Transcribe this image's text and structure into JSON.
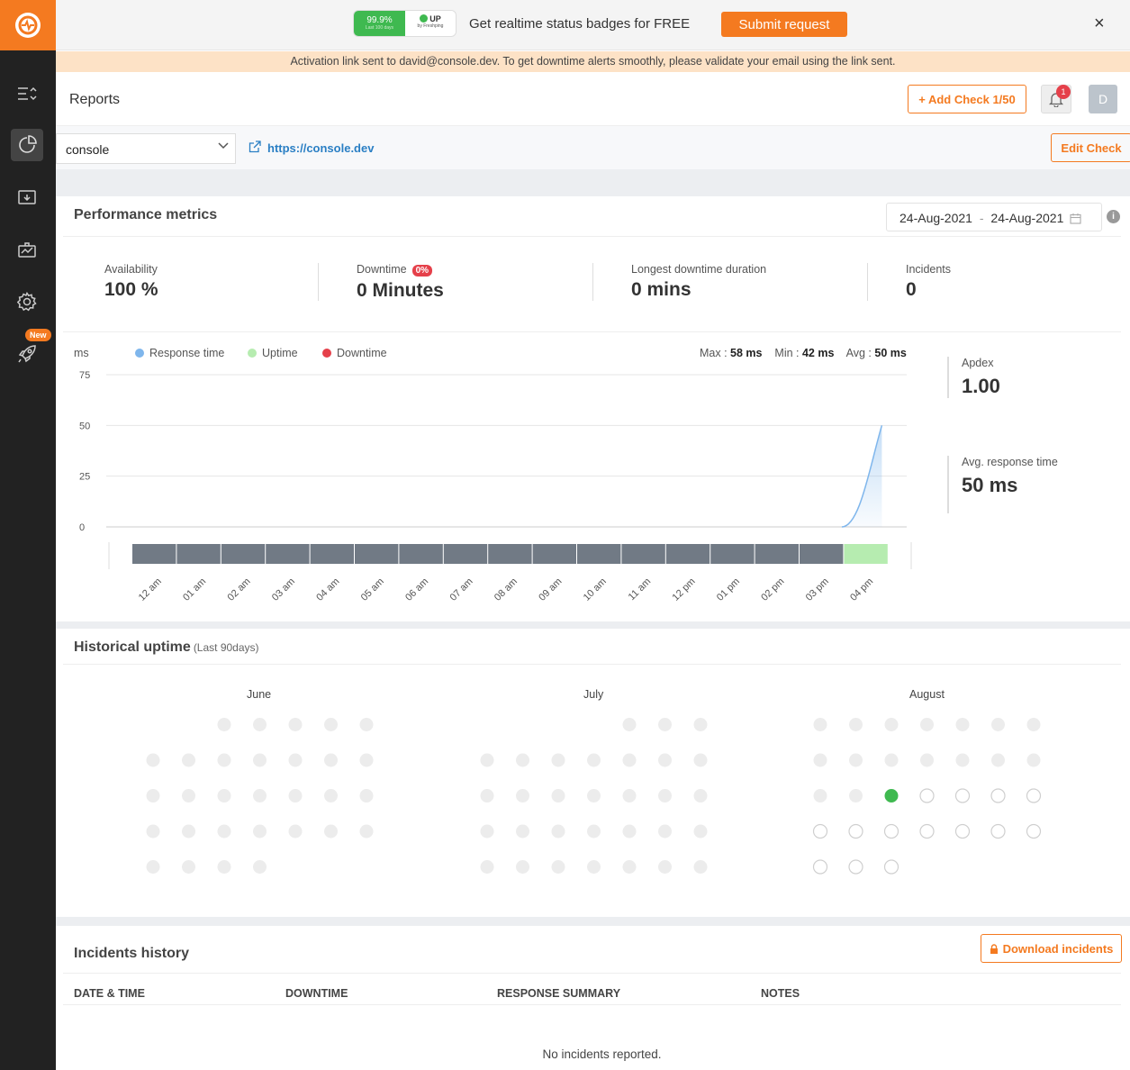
{
  "promo": {
    "badge_pct": "99.9%",
    "badge_sub": "Last 100 days",
    "badge_status": "UP",
    "badge_by": "by Freshping",
    "text": "Get realtime status badges for FREE",
    "submit_label": "Submit request",
    "close_icon": "×"
  },
  "activation": "Activation link sent to david@console.dev. To get downtime alerts smoothly, please validate your email using the link sent.",
  "sidebar": {
    "new_badge": "New",
    "items": [
      "checks-list-icon",
      "reports-icon",
      "status-page-icon",
      "integrations-icon",
      "settings-icon",
      "whats-new-icon"
    ]
  },
  "header": {
    "title": "Reports",
    "add_check_label": "+ Add Check 1/50",
    "notifications": "1",
    "avatar": "D"
  },
  "check": {
    "selected": "console",
    "url": "https://console.dev",
    "edit_label": "Edit Check"
  },
  "performance": {
    "title": "Performance metrics",
    "date_from": "24-Aug-2021",
    "date_sep": "-",
    "date_to": "24-Aug-2021",
    "availability_label": "Availability",
    "availability": "100 %",
    "downtime_label": "Downtime",
    "downtime_pct": "0%",
    "downtime": "0 Minutes",
    "longest_label": "Longest downtime duration",
    "longest": "0 mins",
    "incidents_label": "Incidents",
    "incidents": "0",
    "apdex_label": "Apdex",
    "apdex": "1.00",
    "avg_resp_label": "Avg. response time",
    "avg_resp": "50 ms"
  },
  "chart_data": {
    "type": "area",
    "ylabel": "ms",
    "ylim": [
      0,
      75
    ],
    "yticks": [
      "75",
      "50",
      "25",
      "0"
    ],
    "legend": [
      {
        "name": "Response time",
        "color": "#7fb6ec"
      },
      {
        "name": "Uptime",
        "color": "#b6ecb0"
      },
      {
        "name": "Downtime",
        "color": "#e5404a"
      }
    ],
    "stats": {
      "max_label": "Max :",
      "max": "58 ms",
      "min_label": "Min :",
      "min": "42 ms",
      "avg_label": "Avg :",
      "avg": "50 ms"
    },
    "categories": [
      "12 am",
      "01 am",
      "02 am",
      "03 am",
      "04 am",
      "05 am",
      "06 am",
      "07 am",
      "08 am",
      "09 am",
      "10 am",
      "11 am",
      "12 pm",
      "01 pm",
      "02 pm",
      "03 pm",
      "04 pm"
    ],
    "series": [
      {
        "name": "Response time",
        "x": [
          "03 pm",
          "04 pm"
        ],
        "values": [
          0,
          50
        ]
      }
    ],
    "status_bar": [
      "none",
      "none",
      "none",
      "none",
      "none",
      "none",
      "none",
      "none",
      "none",
      "none",
      "none",
      "none",
      "none",
      "none",
      "none",
      "none",
      "up"
    ],
    "status_colors": {
      "none": "#717a85",
      "up": "#b6ecb0"
    }
  },
  "history": {
    "title": "Historical uptime",
    "subtitle": "(Last 90days)",
    "months": [
      {
        "name": "June",
        "start_col": 2,
        "days": 30
      },
      {
        "name": "July",
        "start_col": 4,
        "days": 31
      },
      {
        "name": "August",
        "start_col": 0,
        "days": 31,
        "up_days": [
          17
        ],
        "future_from": 18
      }
    ],
    "colors": {
      "nodata": "#ececec",
      "up": "#3fb950",
      "future_border": "#cfcfcf"
    }
  },
  "incidents": {
    "title": "Incidents history",
    "download_label": "Download incidents",
    "columns": [
      "DATE & TIME",
      "DOWNTIME",
      "RESPONSE SUMMARY",
      "NOTES"
    ],
    "empty": "No incidents reported."
  },
  "colors": {
    "accent": "#f47a20",
    "sidebar": "#222222",
    "link": "#2a7fc4"
  }
}
